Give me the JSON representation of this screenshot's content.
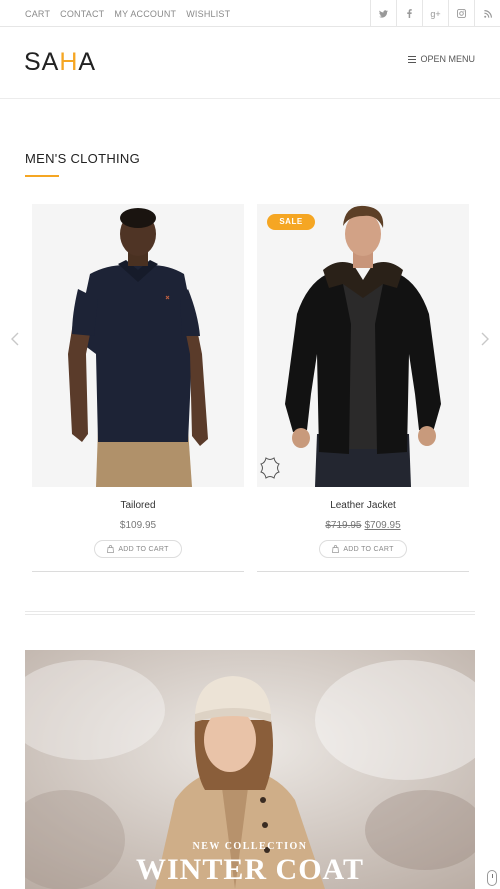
{
  "topbar": {
    "links": [
      "CART",
      "CONTACT",
      "MY ACCOUNT",
      "WISHLIST"
    ],
    "social_icons": [
      "twitter-icon",
      "facebook-icon",
      "google-plus-icon",
      "instagram-icon",
      "rss-icon"
    ]
  },
  "header": {
    "logo_prefix": "SA",
    "logo_highlight": "H",
    "logo_suffix": "A",
    "menu_label": "OPEN MENU",
    "accent_color": "#f5a623"
  },
  "section": {
    "title": "MEN'S CLOTHING"
  },
  "products": [
    {
      "name": "Tailored",
      "price": "$109.95",
      "old_price": "",
      "add_to_cart": "ADD TO CART",
      "badge": ""
    },
    {
      "name": "Leather Jacket",
      "price": "$709.95",
      "old_price": "$719.95",
      "add_to_cart": "ADD TO CART",
      "badge": "SALE"
    }
  ],
  "banner": {
    "subtitle": "NEW COLLECTION",
    "title": "WINTER COAT"
  }
}
